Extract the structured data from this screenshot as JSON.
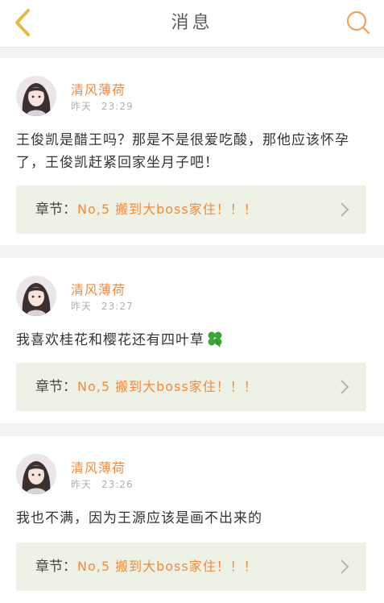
{
  "header": {
    "title": "消息"
  },
  "messages": [
    {
      "username": "清风薄荷",
      "date": "昨天",
      "time": "23:29",
      "text": "王俊凯是醋王吗？那是不是很爱吃酸，那他应该怀孕了，王俊凯赶紧回家坐月子吧！",
      "chapter_prefix": "章节：",
      "chapter_title": "No,5 搬到大boss家住！！！"
    },
    {
      "username": "清风薄荷",
      "date": "昨天",
      "time": "23:27",
      "text": "我喜欢桂花和樱花还有四叶草",
      "emoji": "four-leaf-clover",
      "chapter_prefix": "章节：",
      "chapter_title": "No,5 搬到大boss家住！！！"
    },
    {
      "username": "清风薄荷",
      "date": "昨天",
      "time": "23:26",
      "text": "我也不满，因为王源应该是画不出来的",
      "chapter_prefix": "章节：",
      "chapter_title": "No,5 搬到大boss家住！！！"
    }
  ],
  "colors": {
    "accent": "#f08a3c",
    "back_arrow": "#e8b84a",
    "chapter_bg": "#eef2e6",
    "page_bg": "#f2f2f2"
  }
}
